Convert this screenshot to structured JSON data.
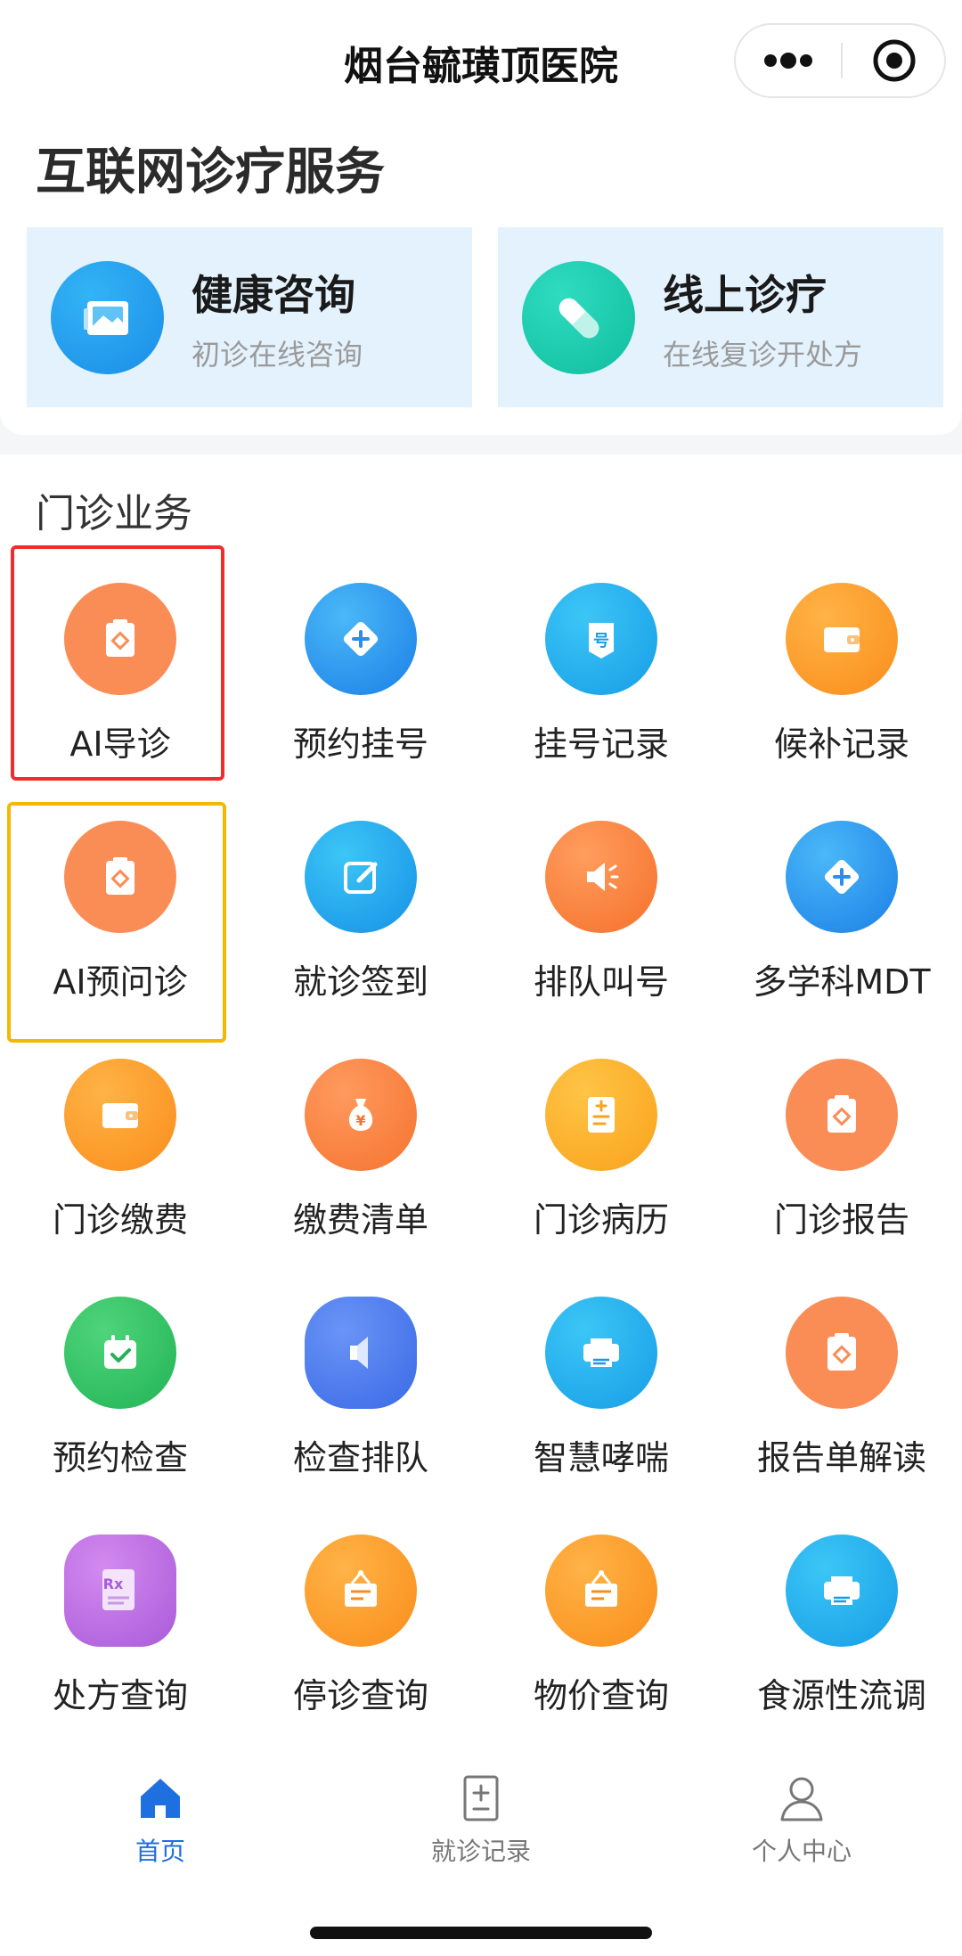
{
  "header": {
    "title": "烟台毓璜顶医院"
  },
  "internet": {
    "title": "互联网诊疗服务",
    "services": [
      {
        "name": "健康咨询",
        "sub": "初诊在线咨询",
        "icon": "photo-card-icon"
      },
      {
        "name": "线上诊疗",
        "sub": "在线复诊开处方",
        "icon": "pill-capsule-icon"
      }
    ]
  },
  "outpatient": {
    "title": "门诊业务",
    "items": [
      {
        "label": "AI导诊",
        "icon": "clipboard-icon"
      },
      {
        "label": "预约挂号",
        "icon": "diamond-plus-icon"
      },
      {
        "label": "挂号记录",
        "icon": "ticket-number-icon"
      },
      {
        "label": "候补记录",
        "icon": "wallet-icon"
      },
      {
        "label": "AI预问诊",
        "icon": "clipboard-icon"
      },
      {
        "label": "就诊签到",
        "icon": "edit-square-icon"
      },
      {
        "label": "排队叫号",
        "icon": "speaker-icon"
      },
      {
        "label": "多学科MDT",
        "icon": "diamond-plus-icon"
      },
      {
        "label": "门诊缴费",
        "icon": "wallet-icon"
      },
      {
        "label": "缴费清单",
        "icon": "money-bag-icon"
      },
      {
        "label": "门诊病历",
        "icon": "medical-record-icon"
      },
      {
        "label": "门诊报告",
        "icon": "clipboard-icon"
      },
      {
        "label": "预约检查",
        "icon": "calendar-check-icon"
      },
      {
        "label": "检查排队",
        "icon": "speaker-icon"
      },
      {
        "label": "智慧哮喘",
        "icon": "printer-icon"
      },
      {
        "label": "报告单解读",
        "icon": "clipboard-icon"
      },
      {
        "label": "处方查询",
        "icon": "prescription-icon"
      },
      {
        "label": "停诊查询",
        "icon": "notice-board-icon"
      },
      {
        "label": "物价查询",
        "icon": "notice-board-icon"
      },
      {
        "label": "食源性流调",
        "icon": "printer-icon"
      }
    ]
  },
  "tabbar": {
    "items": [
      {
        "label": "首页",
        "active": true,
        "icon": "home-icon"
      },
      {
        "label": "就诊记录",
        "active": false,
        "icon": "record-icon"
      },
      {
        "label": "个人中心",
        "active": false,
        "icon": "user-icon"
      }
    ]
  },
  "colors": {
    "active_tab": "#1e6fe0",
    "highlight_red": "#f02c2c",
    "highlight_yellow": "#f5b800",
    "service_bg": "#e4f2fd"
  }
}
